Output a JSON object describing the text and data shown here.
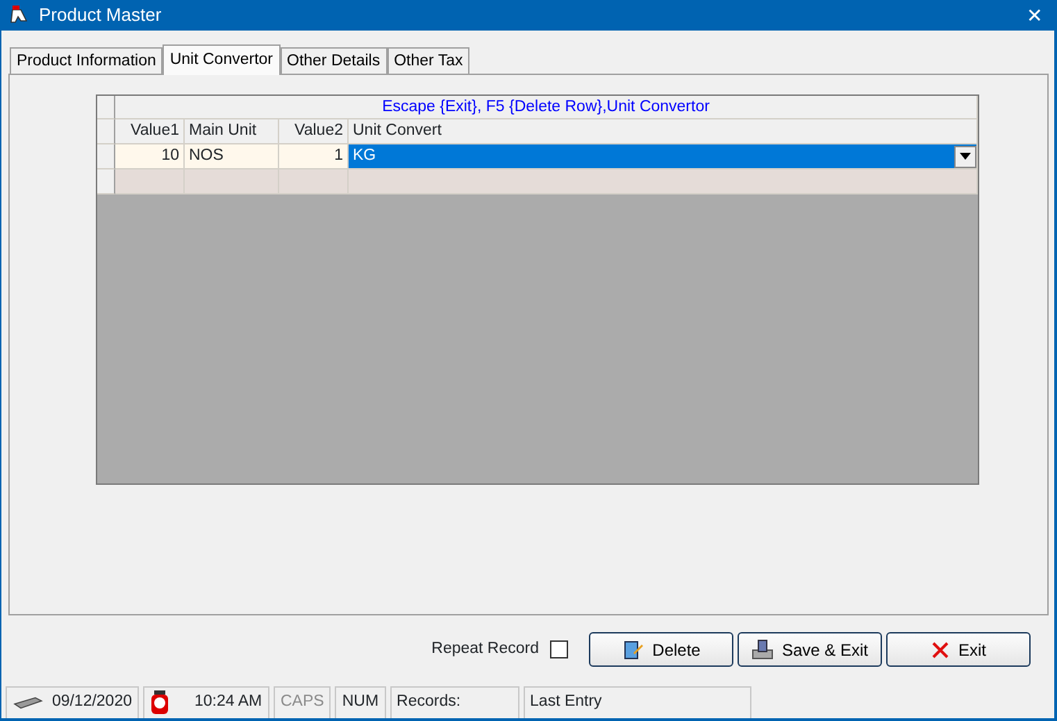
{
  "window": {
    "title": "Product Master",
    "close": "✕"
  },
  "tabs": [
    {
      "label": "Product Information",
      "selected": false
    },
    {
      "label": "Unit Convertor",
      "selected": true
    },
    {
      "label": "Other Details",
      "selected": false
    },
    {
      "label": "Other Tax",
      "selected": false
    }
  ],
  "grid": {
    "caption": "Escape {Exit}, F5 {Delete Row},Unit Convertor",
    "columns": [
      {
        "label": "Value1",
        "kind": "number"
      },
      {
        "label": "Main Unit",
        "kind": "text"
      },
      {
        "label": "Value2",
        "kind": "number"
      },
      {
        "label": "Unit Convert",
        "kind": "text"
      }
    ],
    "rows": [
      {
        "cells": [
          "10",
          "NOS",
          "1",
          "KG"
        ],
        "selected": true
      },
      {
        "cells": [],
        "selected": false
      }
    ]
  },
  "repeat_record": {
    "label": "Repeat Record",
    "checked": false
  },
  "buttons": [
    {
      "label": "Delete",
      "kind": "delete"
    },
    {
      "label": "Save & Exit",
      "kind": "save"
    },
    {
      "label": "Exit",
      "kind": "exit"
    }
  ],
  "status_bar": {
    "date": "09/12/2020",
    "time": "10:24 AM",
    "caps": {
      "label": "CAPS",
      "on": false
    },
    "num": {
      "label": "NUM",
      "on": true
    },
    "records": "Records:",
    "last_entry": "Last Entry"
  }
}
